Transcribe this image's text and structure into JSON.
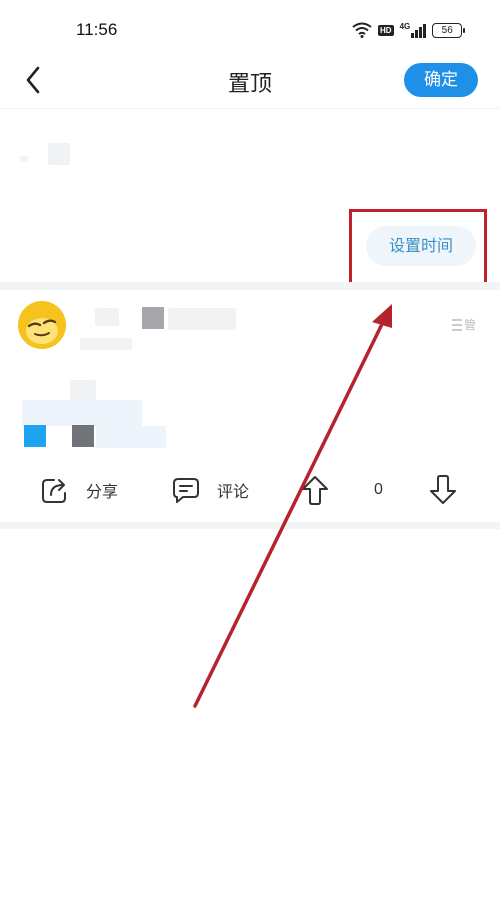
{
  "status_bar": {
    "time": "11:56",
    "network": "4G",
    "hd_label": "HD",
    "battery": "56"
  },
  "header": {
    "title": "置顶",
    "confirm_label": "确定"
  },
  "pin": {
    "set_time_label": "设置时间"
  },
  "post": {
    "menu_label": "管"
  },
  "actions": {
    "share_label": "分享",
    "comment_label": "评论",
    "vote_count": "0"
  },
  "colors": {
    "accent": "#1e90e8",
    "highlight": "#c0202a",
    "avatar": "#f6c21e"
  }
}
